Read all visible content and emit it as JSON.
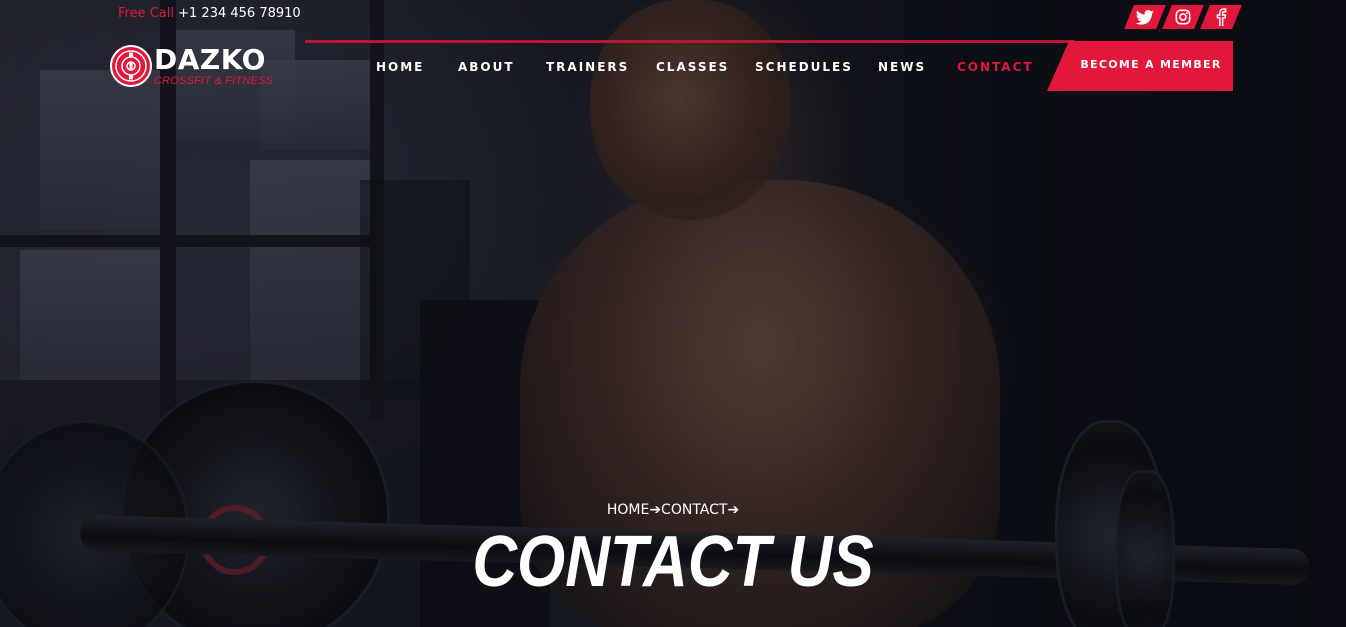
{
  "topbar": {
    "call_label": "Free Call",
    "call_number": "+1 234 456 78910",
    "socials": [
      {
        "icon": "twitter-icon"
      },
      {
        "icon": "instagram-icon"
      },
      {
        "icon": "facebook-icon"
      }
    ]
  },
  "brand": {
    "name": "DAZKO",
    "tagline": "CROSSFIT & FITNESS",
    "logo_icon": "weight-plate-icon"
  },
  "nav": {
    "items": [
      {
        "label": "HOME",
        "active": false
      },
      {
        "label": "ABOUT",
        "active": false
      },
      {
        "label": "TRAINERS",
        "active": false
      },
      {
        "label": "CLASSES",
        "active": false
      },
      {
        "label": "SCHEDULES",
        "active": false
      },
      {
        "label": "NEWS",
        "active": false
      },
      {
        "label": "CONTACT",
        "active": true
      }
    ],
    "cta_label": "BECOME A MEMBER"
  },
  "breadcrumb": {
    "items": [
      "HOME",
      "CONTACT"
    ],
    "separator": "➔"
  },
  "page": {
    "title": "CONTACT US"
  },
  "colors": {
    "accent": "#e3163c",
    "background": "#14151d",
    "text": "#ffffff"
  }
}
